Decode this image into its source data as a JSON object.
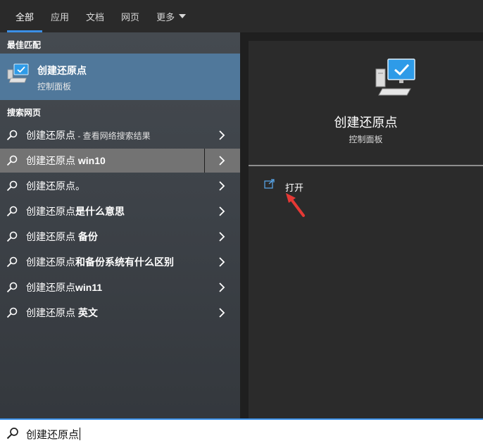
{
  "tabs": [
    {
      "label": "全部",
      "active": true
    },
    {
      "label": "应用",
      "active": false
    },
    {
      "label": "文档",
      "active": false
    },
    {
      "label": "网页",
      "active": false
    },
    {
      "label": "更多",
      "active": false
    }
  ],
  "sections": {
    "best_match": "最佳匹配",
    "search_web": "搜索网页"
  },
  "best_match": {
    "name": "创建还原点",
    "type": "控制面板",
    "icon": "computer-icon"
  },
  "web_results": [
    {
      "prefix": "创建还原点",
      "bold": "",
      "suffix": " - 查看网络搜索结果"
    },
    {
      "prefix": "创建还原点 ",
      "bold": "win10",
      "suffix": ""
    },
    {
      "prefix": "创建还原点。",
      "bold": "",
      "suffix": ""
    },
    {
      "prefix": "创建还原点",
      "bold": "是什么意思",
      "suffix": ""
    },
    {
      "prefix": "创建还原点 ",
      "bold": "备份",
      "suffix": ""
    },
    {
      "prefix": "创建还原点",
      "bold": "和备份系统有什么区别",
      "suffix": ""
    },
    {
      "prefix": "创建还原点",
      "bold": "win11",
      "suffix": ""
    },
    {
      "prefix": "创建还原点 ",
      "bold": "英文",
      "suffix": ""
    }
  ],
  "preview": {
    "title": "创建还原点",
    "subtitle": "控制面板",
    "action_open": "打开"
  },
  "search": {
    "value": "创建还原点"
  },
  "colors": {
    "accent": "#3b8fe6",
    "best_match_bg": "#50789b",
    "hover_row_bg": "#737373",
    "annotation_arrow": "#e53935"
  }
}
